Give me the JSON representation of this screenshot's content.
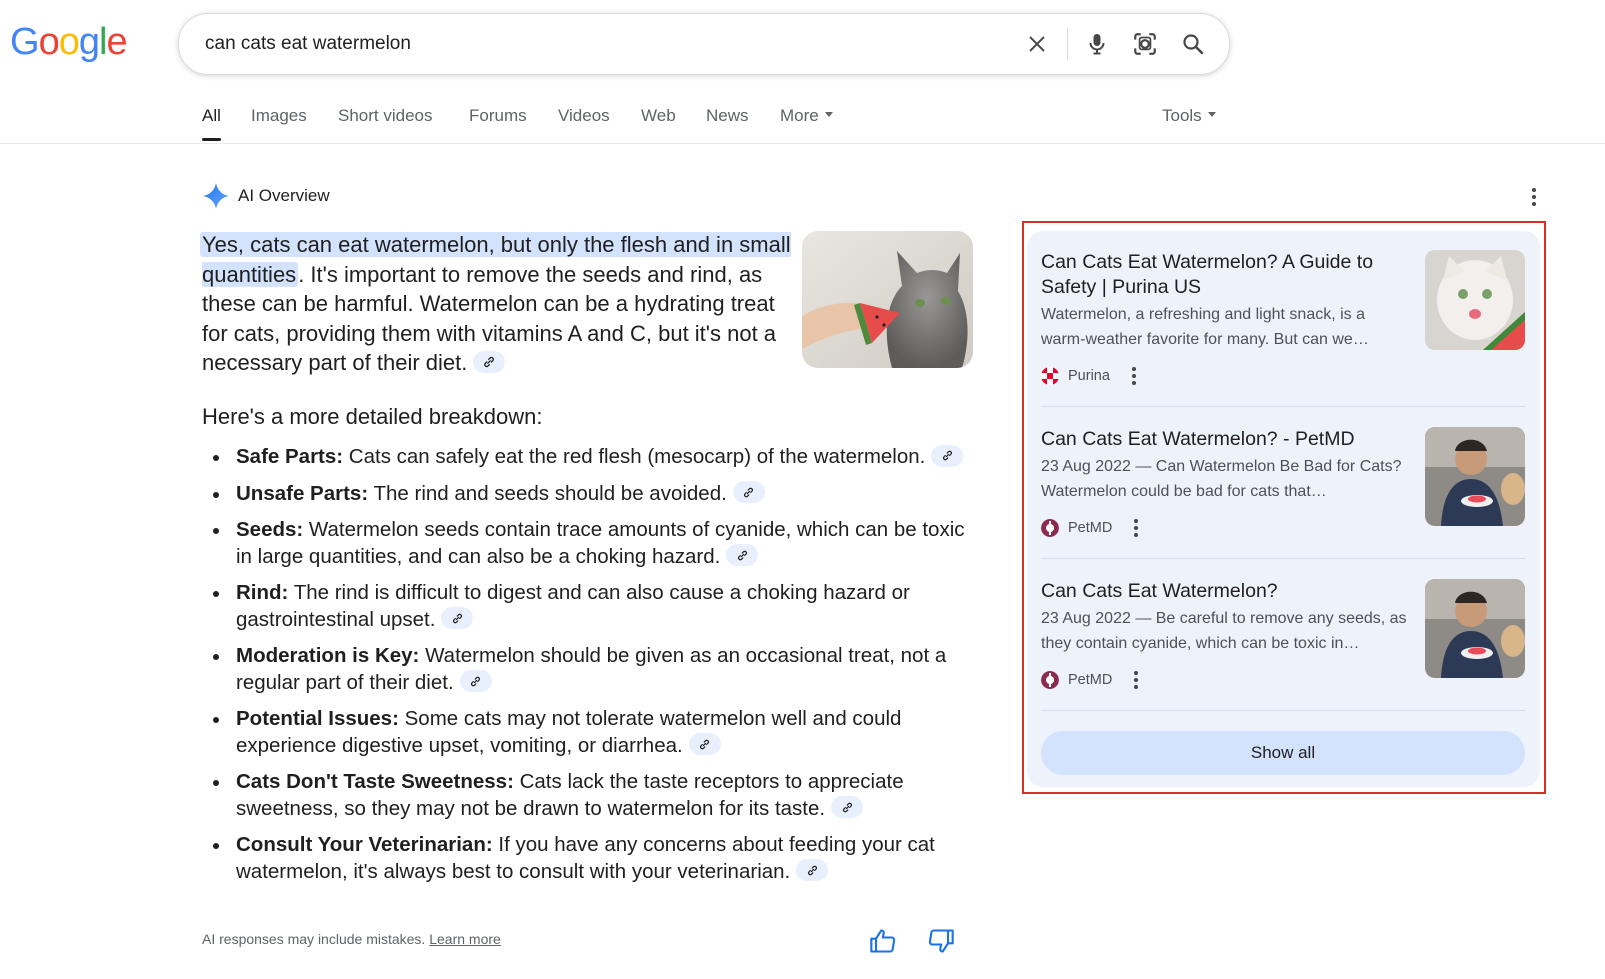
{
  "logo": {
    "text": "Google"
  },
  "search": {
    "query": "can cats eat watermelon",
    "icons": [
      "close-icon",
      "microphone-icon",
      "lens-icon",
      "search-icon"
    ]
  },
  "tabs": [
    {
      "label": "All",
      "active": true
    },
    {
      "label": "Images"
    },
    {
      "label": "Short videos"
    },
    {
      "label": "Forums"
    },
    {
      "label": "Videos"
    },
    {
      "label": "Web"
    },
    {
      "label": "News"
    },
    {
      "label": "More"
    }
  ],
  "tools_label": "Tools",
  "ai_overview": {
    "label": "AI Overview",
    "lead_highlight": "Yes, cats can eat watermelon, but only the flesh and in small quantities",
    "lead_rest": ". It's important to remove the seeds and rind, as these can be harmful. Watermelon can be a hydrat­ing treat for cats, providing them with vitamins A and C, but it's not a necessary part of their diet.",
    "breakdown_heading": "Here's a more detailed breakdown:",
    "bullets": [
      {
        "term": "Safe Parts:",
        "text": " Cats can safely eat the red flesh (mesocarp) of the watermelon."
      },
      {
        "term": "Unsafe Parts:",
        "text": " The rind and seeds should be avoided."
      },
      {
        "term": "Seeds:",
        "text": " Watermelon seeds contain trace amounts of cyanide, which can be toxic in large quantities, and can also be a choking hazard."
      },
      {
        "term": "Rind:",
        "text": " The rind is difficult to digest and can also cause a choking hazard or gastrointestinal upset."
      },
      {
        "term": "Moderation is Key:",
        "text": " Watermelon should be given as an occasional treat, not a regular part of their diet."
      },
      {
        "term": "Potential Issues:",
        "text": " Some cats may not tolerate watermelon well and could experience digestive upset, vomiting, or diarrhea."
      },
      {
        "term": "Cats Don't Taste Sweetness:",
        "text": " Cats lack the taste receptors to appreciate sweetness, so they may not be drawn to watermelon for its taste."
      },
      {
        "term": "Consult Your Veterinarian:",
        "text": " If you have any concerns about feeding your cat watermelon, it's always best to consult with your veterinarian."
      }
    ],
    "disclaimer": "AI responses may include mistakes.",
    "learn_more": "Learn more"
  },
  "sources": [
    {
      "title": "Can Cats Eat Watermelon? A Guide to Safety | Purina US",
      "snippet": "Watermelon, a refreshing and light snack, is a warm-weather favorite for many. But can we…",
      "site": "Purina"
    },
    {
      "title": "Can Cats Eat Watermelon? - PetMD",
      "snippet": "23 Aug 2022 — Can Watermelon Be Bad for Cats? Watermelon could be bad for cats that…",
      "site": "PetMD"
    },
    {
      "title": "Can Cats Eat Watermelon?",
      "snippet": "23 Aug 2022 — Be careful to remove any seeds, as they contain cyanide, which can be toxic in…",
      "site": "PetMD"
    }
  ],
  "show_all_label": "Show all",
  "colors": {
    "accent_blue": "#4285f4",
    "highlight": "#d3e3fd",
    "panel_bg": "#eef2fb",
    "selection_border": "#d93025"
  }
}
